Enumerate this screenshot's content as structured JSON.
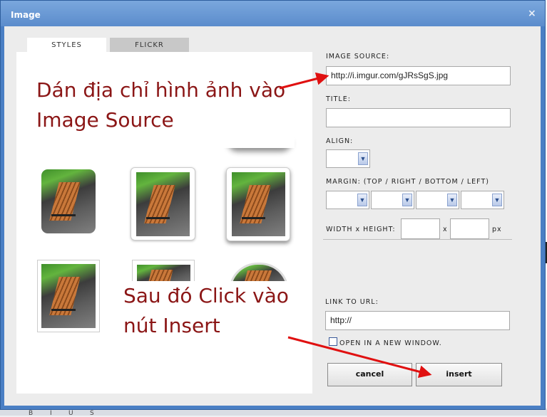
{
  "window": {
    "title": "Image",
    "close_glyph": "×"
  },
  "tabs": [
    {
      "label": "STYLES",
      "active": true
    },
    {
      "label": "FLICKR",
      "active": false
    }
  ],
  "annotations": {
    "top_line1": "Dán địa chỉ hình ảnh vào",
    "top_line2": "Image Source",
    "bottom_line1": "Sau đó Click vào",
    "bottom_line2": "nút Insert"
  },
  "form": {
    "image_source_label": "IMAGE SOURCE:",
    "image_source_value": "http://i.imgur.com/gJRsSgS.jpg",
    "title_label": "TITLE:",
    "title_value": "",
    "align_label": "ALIGN:",
    "margin_label": "MARGIN: (TOP / RIGHT / BOTTOM / LEFT)",
    "size_label": "WIDTH x HEIGHT:",
    "size_sep": "x",
    "size_unit": "px",
    "link_label": "LINK TO URL:",
    "link_value": "http://",
    "new_window_label": "OPEN IN A NEW WINDOW.",
    "new_window_checked": false
  },
  "buttons": {
    "cancel": "cancel",
    "insert": "insert"
  },
  "icons": {
    "close": "close-icon",
    "dropdown": "chevron-down-icon"
  },
  "colors": {
    "title_bar": "#5b8ccc",
    "annotation_text": "#8b1616",
    "arrow": "#e01010"
  },
  "taskbar_glyphs": [
    "B",
    "I",
    "U",
    "S"
  ]
}
